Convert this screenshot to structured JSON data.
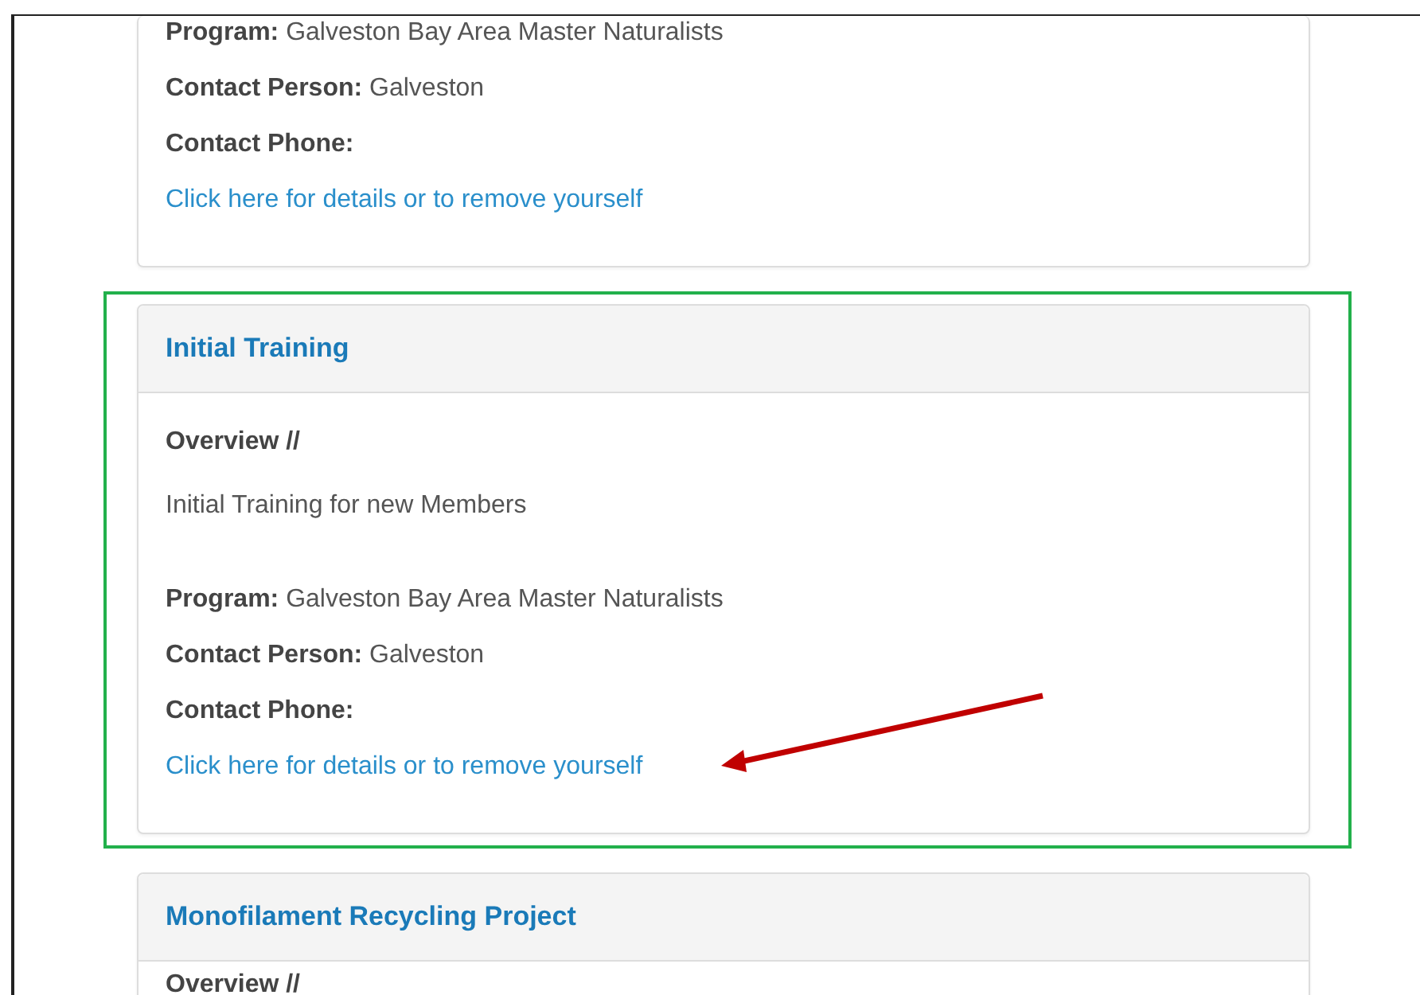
{
  "cards": [
    {
      "fields": [
        {
          "label": "Program:",
          "value": "Galveston Bay Area Master Naturalists"
        },
        {
          "label": "Contact Person:",
          "value": "Galveston"
        },
        {
          "label": "Contact Phone:"
        }
      ],
      "link": "Click here for details or to remove yourself"
    },
    {
      "highlighted": true,
      "arrow": true,
      "title": "Initial Training",
      "overview_label": "Overview //",
      "overview": "Initial Training for new Members",
      "fields": [
        {
          "label": "Program:",
          "value": "Galveston Bay Area Master Naturalists"
        },
        {
          "label": "Contact Person:",
          "value": "Galveston"
        },
        {
          "label": "Contact Phone:"
        }
      ],
      "link": "Click here for details or to remove yourself"
    },
    {
      "title": "Monofilament Recycling Project",
      "overview_label": "Overview //"
    }
  ]
}
